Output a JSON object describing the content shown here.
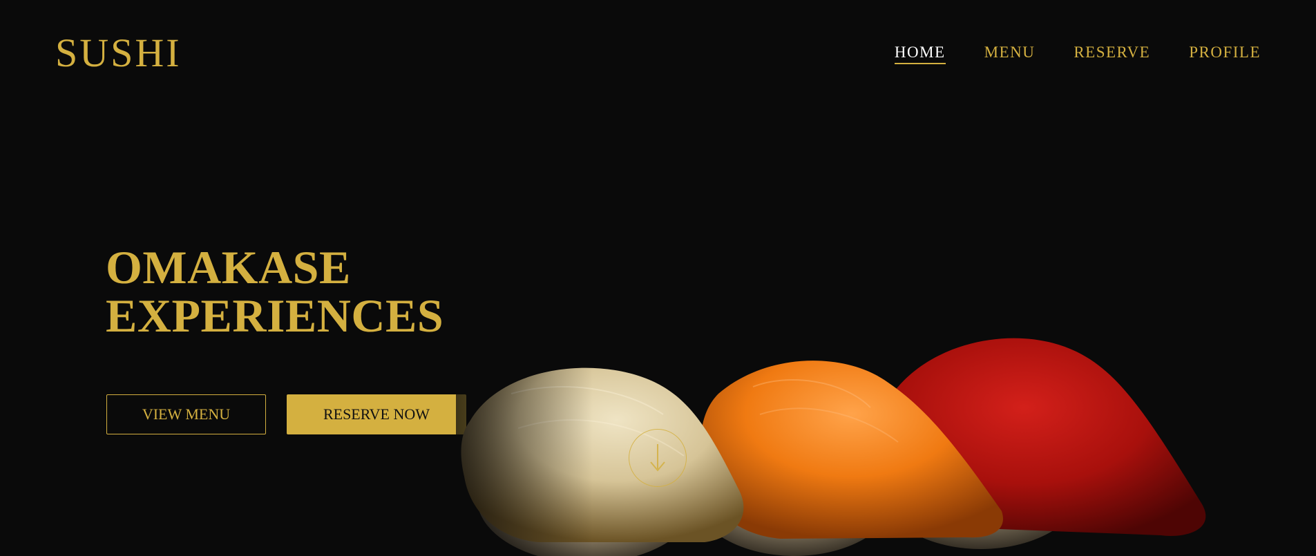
{
  "brand": {
    "logo": "SUSHI"
  },
  "nav": {
    "items": [
      {
        "label": "HOME",
        "active": true
      },
      {
        "label": "MENU",
        "active": false
      },
      {
        "label": "RESERVE",
        "active": false
      },
      {
        "label": "PROFILE",
        "active": false
      }
    ]
  },
  "hero": {
    "title_line1": "OMAKASE",
    "title_line2": "EXPERIENCES",
    "view_menu_label": "VIEW MENU",
    "reserve_now_label": "RESERVE NOW"
  },
  "scroll": {
    "icon": "arrow-down-icon"
  },
  "colors": {
    "accent": "#d4b040",
    "background": "#0a0a0a",
    "active_nav": "#ffffff"
  }
}
